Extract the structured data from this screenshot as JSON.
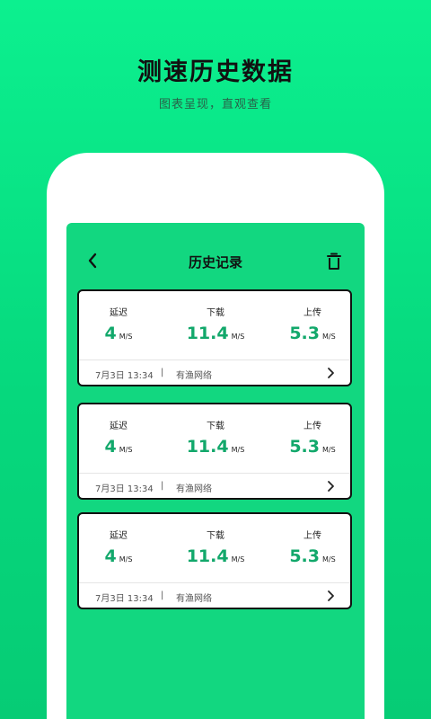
{
  "promo": {
    "title": "测速历史数据",
    "subtitle": "图表呈现，直观查看"
  },
  "screen": {
    "header": {
      "title": "历史记录",
      "back_icon": "chevron-left-icon",
      "trash_icon": "trash-icon"
    },
    "labels": {
      "latency": "延迟",
      "download": "下载",
      "upload": "上传",
      "unit": "M/S"
    },
    "records": [
      {
        "latency": "4",
        "download": "11.4",
        "upload": "5.3",
        "time": "7月3日 13:34",
        "network": "有渔网络"
      },
      {
        "latency": "4",
        "download": "11.4",
        "upload": "5.3",
        "time": "7月3日 13:34",
        "network": "有渔网络"
      },
      {
        "latency": "4",
        "download": "11.4",
        "upload": "5.3",
        "time": "7月3日 13:34",
        "network": "有渔网络"
      }
    ]
  },
  "colors": {
    "background": "#0cf08f",
    "screen": "#12d780",
    "value_green": "#12a86b",
    "border": "#111111"
  }
}
